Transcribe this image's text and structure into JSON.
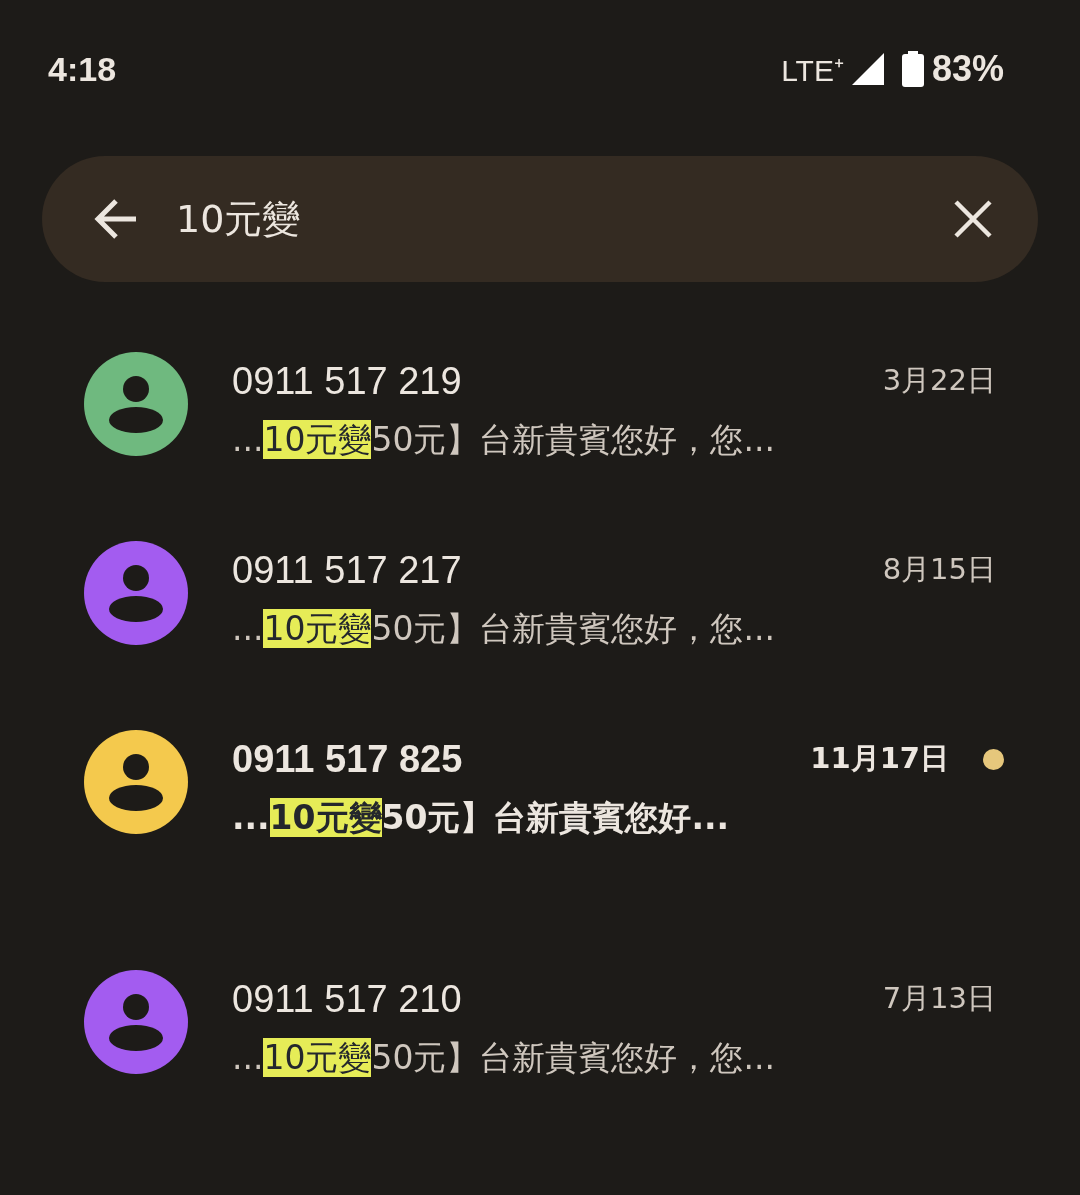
{
  "status_bar": {
    "time": "4:18",
    "network": "LTE⁺",
    "battery": "83%"
  },
  "search": {
    "value": "10元變"
  },
  "results": [
    {
      "name": "0911 517 219",
      "date": "3月22日",
      "before": "...",
      "match": "10元變",
      "after": "50元】台新貴賓您好，您...",
      "unread": false,
      "color": "#6fb97f"
    },
    {
      "name": "0911 517 217",
      "date": "8月15日",
      "before": "...",
      "match": "10元變",
      "after": "50元】台新貴賓您好，您...",
      "unread": false,
      "color": "#a35cf0"
    },
    {
      "name": "0911 517 825",
      "date": "11月17日",
      "before": "...",
      "match": "10元變",
      "after": "50元】台新貴賓您好...",
      "unread": true,
      "color": "#f4c94d"
    },
    {
      "name": "0911 517 210",
      "date": "7月13日",
      "before": "...",
      "match": "10元變",
      "after": "50元】台新貴賓您好，您...",
      "unread": false,
      "color": "#a35cf0"
    }
  ]
}
